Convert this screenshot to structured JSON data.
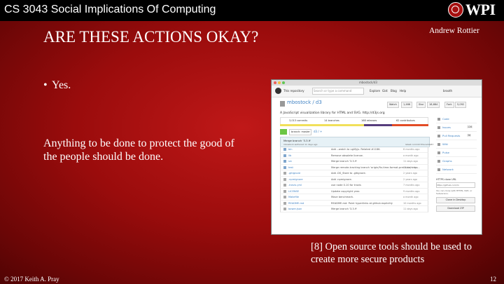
{
  "header": {
    "course": "CS 3043 Social Implications Of Computing",
    "logo_text": "WPI",
    "logo_icon": "wpi-seal-icon"
  },
  "author": "Andrew Rottier",
  "title": "ARE THESE ACTIONS OKAY?",
  "bullets": [
    {
      "marker": "•",
      "text": "Yes."
    }
  ],
  "paragraph": "Anything to be done to protect the good of the people should be done.",
  "caption": "[8] Open source tools should be used to create more secure products",
  "footer": {
    "copyright": "© 2017 Keith A. Pray",
    "page": "12"
  },
  "colors": {
    "background": "#9a0c0c",
    "topbar": "#000000",
    "text": "#ffffff"
  },
  "screenshot": {
    "url": "mbostock/d3",
    "nav": [
      "This repository",
      "Search or type a command",
      "Explore",
      "Gist",
      "Blog",
      "Help"
    ],
    "user": "brooth",
    "repo_name": "mbostock / d3",
    "buttons": {
      "watch": "Watch",
      "watch_count": "1,466",
      "star": "Star",
      "star_count": "18,684",
      "fork": "Fork",
      "fork_count": "5,092"
    },
    "description": "A JavaScript visualization library for HTML and SVG. http://d3js.org",
    "stats": [
      "3,013 commits",
      "14 branches",
      "168 releases",
      "62 contributors"
    ],
    "branch": "branch: master",
    "breadcrumb": "d3 / +",
    "commit": {
      "message": "Merge branch '3.3.9'",
      "author": "mbostock authored 11 days ago",
      "latest": "latest commit 87ace1bb87"
    },
    "files": [
      {
        "name": "bin",
        "message": "Add --watch to uglifyjs. Related #1186.",
        "age": "6 months ago",
        "kind": "dir"
      },
      {
        "name": "lib",
        "message": "Remove obsolete license.",
        "age": "a month ago",
        "kind": "dir"
      },
      {
        "name": "src",
        "message": "Merge branch '3.3.9'",
        "age": "11 days ago",
        "kind": "dir"
      },
      {
        "name": "test",
        "message": "Merge remote-tracking branch 'origin/fix-time-format-precision' into ...",
        "age": "11 days ago",
        "kind": "dir"
      },
      {
        "name": ".gitignore",
        "message": "Add .DS_Store to .gitignore.",
        "age": "2 years ago",
        "kind": "file"
      },
      {
        "name": ".npmignore",
        "message": "Add .npmignore.",
        "age": "2 years ago",
        "kind": "file"
      },
      {
        "name": ".travis.yml",
        "message": "use node 0.10 for travis",
        "age": "7 months ago",
        "kind": "file"
      },
      {
        "name": "LICENSE",
        "message": "Update copyright year.",
        "age": "9 months ago",
        "kind": "file"
      },
      {
        "name": "Makefile",
        "message": "Move benchmark.",
        "age": "a month ago",
        "kind": "file"
      },
      {
        "name": "README.md",
        "message": "README.md: Point hyperlinks at github explicitly",
        "age": "10 months ago",
        "kind": "file"
      },
      {
        "name": "bower.json",
        "message": "Merge branch '3.3.9'",
        "age": "11 days ago",
        "kind": "file"
      }
    ],
    "sidebar": [
      {
        "label": "Code",
        "count": ""
      },
      {
        "label": "Issues",
        "count": "126"
      },
      {
        "label": "Pull Requests",
        "count": "36"
      },
      {
        "label": "Wiki",
        "count": ""
      },
      {
        "label": "Pulse",
        "count": ""
      },
      {
        "label": "Graphs",
        "count": ""
      },
      {
        "label": "Network",
        "count": ""
      }
    ],
    "clone": {
      "label": "HTTPS clone URL",
      "url": "https://github.com/m",
      "note": "You can clone with HTTPS, SSH, or Subversion.",
      "desktop": "Clone in Desktop",
      "zip": "Download ZIP"
    }
  }
}
